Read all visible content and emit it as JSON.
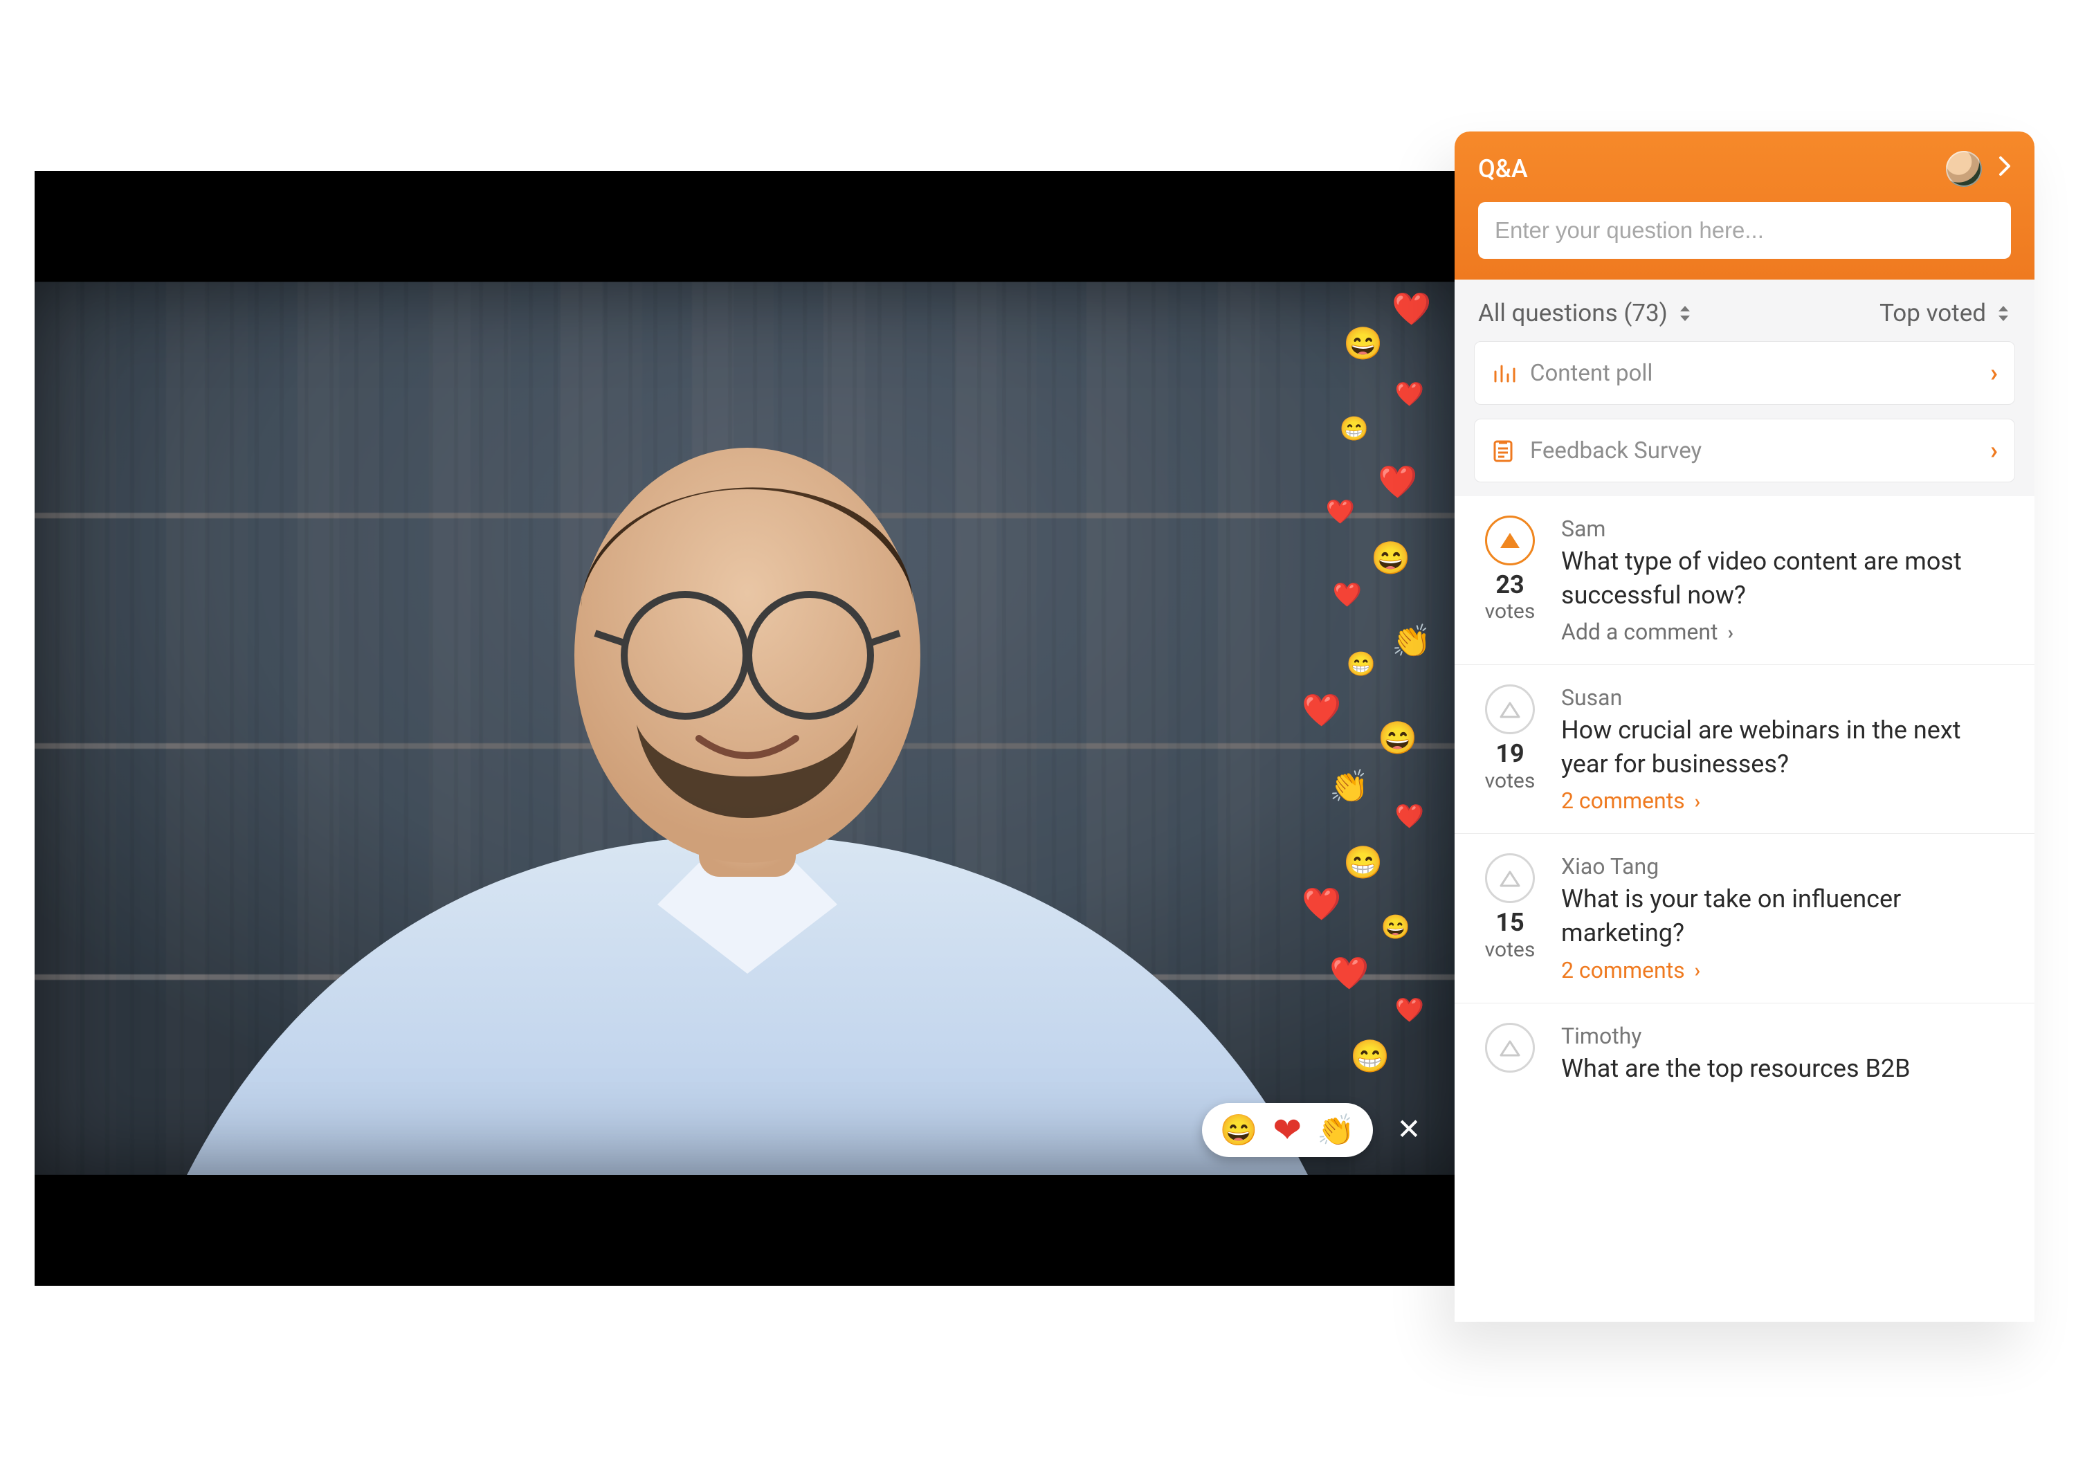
{
  "qa": {
    "title": "Q&A",
    "input_placeholder": "Enter your question here...",
    "filter_all": "All questions (73)",
    "filter_sort": "Top voted",
    "pinned": [
      {
        "icon": "poll",
        "label": "Content poll"
      },
      {
        "icon": "survey",
        "label": "Feedback Survey"
      }
    ],
    "questions": [
      {
        "name": "Sam",
        "text": "What type of video content are most successful now?",
        "votes": 23,
        "votes_label": "votes",
        "link_text": "Add a comment",
        "link_style": "gray",
        "active": true
      },
      {
        "name": "Susan",
        "text": "How crucial are webinars in the next year for businesses?",
        "votes": 19,
        "votes_label": "votes",
        "link_text": "2 comments",
        "link_style": "orange",
        "active": false
      },
      {
        "name": "Xiao Tang",
        "text": "What is your take on influencer marketing?",
        "votes": 15,
        "votes_label": "votes",
        "link_text": "2 comments",
        "link_style": "orange",
        "active": false
      },
      {
        "name": "Timothy",
        "text": "What are the top resources B2B",
        "votes": null,
        "votes_label": "",
        "link_text": "",
        "link_style": "",
        "active": false
      }
    ]
  },
  "reaction_tray": {
    "reactions": [
      "grin",
      "heart",
      "clap"
    ]
  }
}
